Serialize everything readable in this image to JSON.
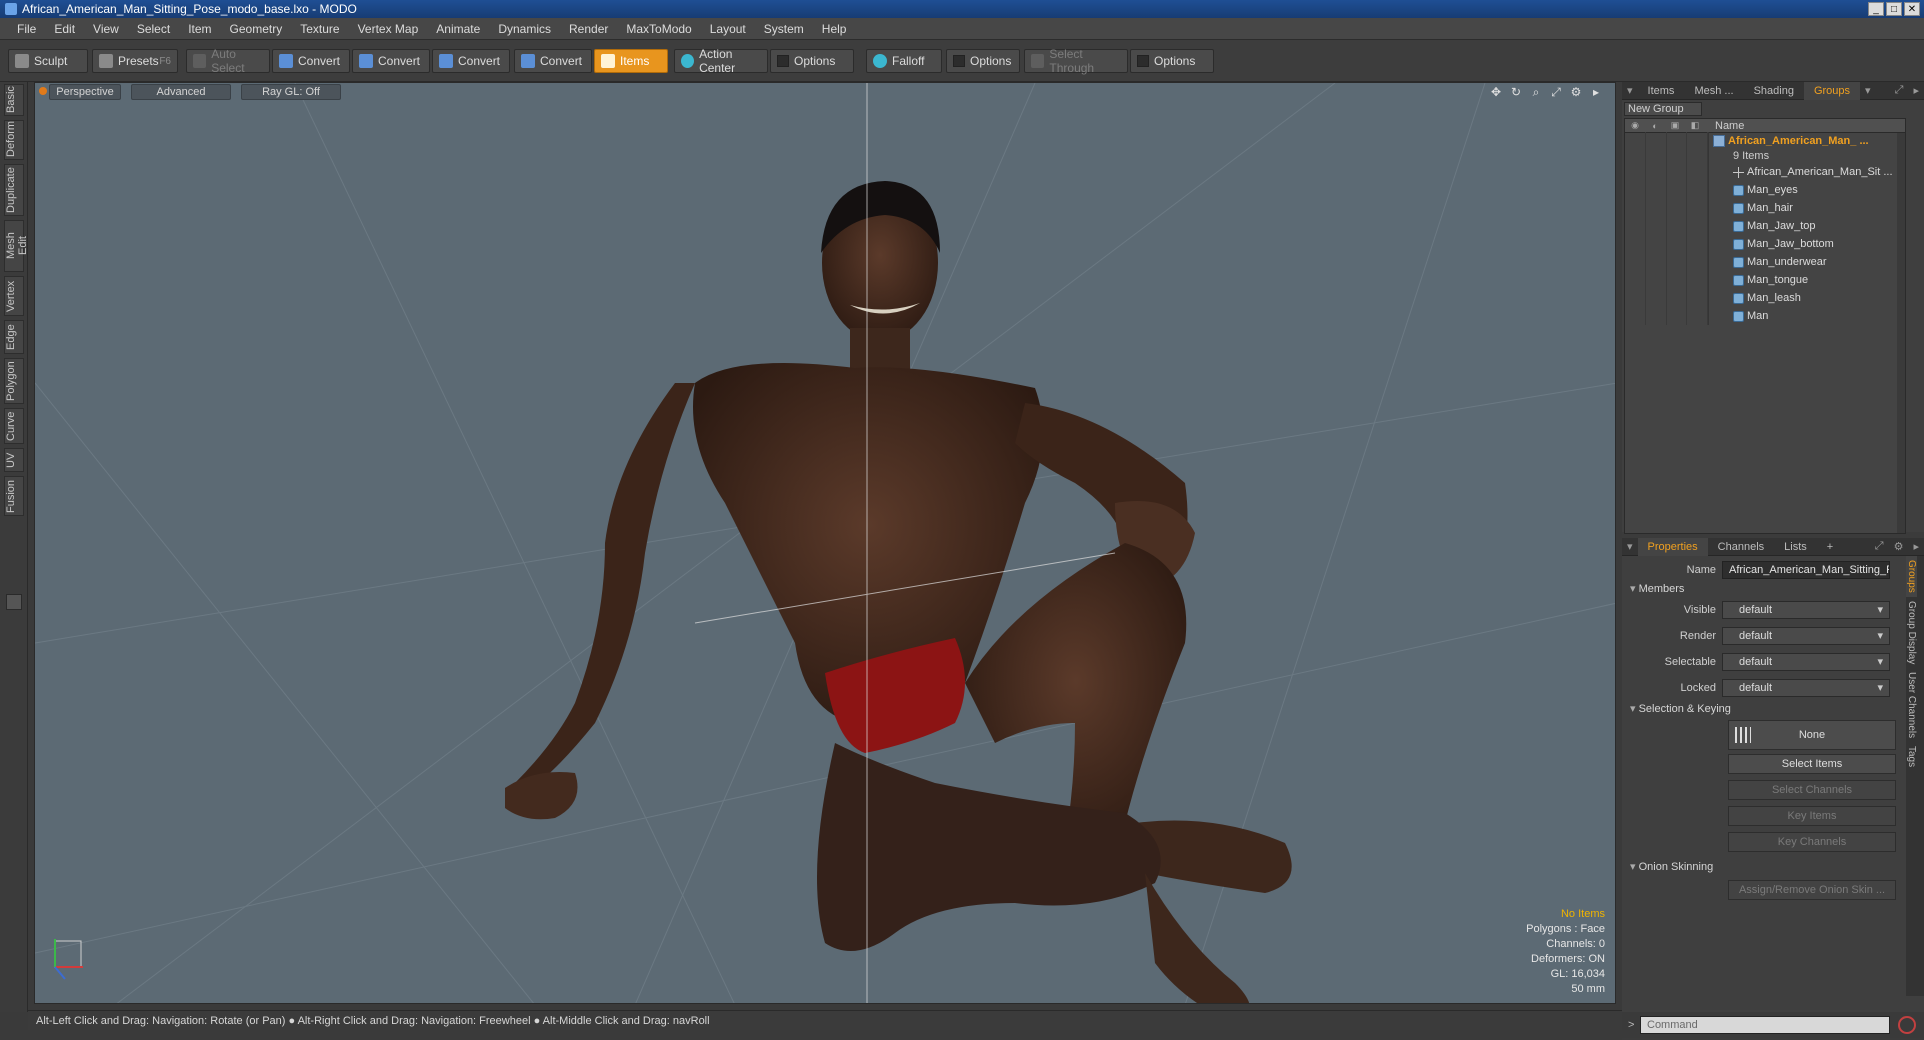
{
  "window": {
    "title": "African_American_Man_Sitting_Pose_modo_base.lxo - MODO"
  },
  "menu": [
    "File",
    "Edit",
    "View",
    "Select",
    "Item",
    "Geometry",
    "Texture",
    "Vertex Map",
    "Animate",
    "Dynamics",
    "Render",
    "MaxToModo",
    "Layout",
    "System",
    "Help"
  ],
  "toolbar": {
    "sculpt": "Sculpt",
    "presets": "Presets",
    "presets_key": "F6",
    "auto_select": "Auto Select",
    "convert": "Convert",
    "items": "Items",
    "action_center": "Action Center",
    "options": "Options",
    "falloff": "Falloff",
    "select_through": "Select Through"
  },
  "left_tabs": [
    "Basic",
    "Deform",
    "Duplicate",
    "Mesh Edit",
    "Vertex",
    "Edge",
    "Polygon",
    "Curve",
    "UV",
    "Fusion"
  ],
  "viewport": {
    "view": "Perspective",
    "mode": "Advanced",
    "raygl": "Ray GL: Off",
    "info": {
      "no_items": "No Items",
      "polygons": "Polygons : Face",
      "channels": "Channels: 0",
      "deformers": "Deformers: ON",
      "gl": "GL: 16,034",
      "focal": "50 mm"
    }
  },
  "right_top_tabs": [
    "Items",
    "Mesh ...",
    "Shading",
    "Groups"
  ],
  "groups": {
    "new_group": "New Group",
    "name_header": "Name",
    "group_name": "African_American_Man_ ...",
    "group_count": "9 Items",
    "children": [
      {
        "label": "African_American_Man_Sit ...",
        "icon": "locator-icon"
      },
      {
        "label": "Man_eyes",
        "icon": "mesh-icon"
      },
      {
        "label": "Man_hair",
        "icon": "mesh-icon"
      },
      {
        "label": "Man_Jaw_top",
        "icon": "mesh-icon"
      },
      {
        "label": "Man_Jaw_bottom",
        "icon": "mesh-icon"
      },
      {
        "label": "Man_underwear",
        "icon": "mesh-icon"
      },
      {
        "label": "Man_tongue",
        "icon": "mesh-icon"
      },
      {
        "label": "Man_leash",
        "icon": "mesh-icon"
      },
      {
        "label": "Man",
        "icon": "mesh-icon"
      }
    ]
  },
  "props_tabs": [
    "Properties",
    "Channels",
    "Lists",
    "+"
  ],
  "properties": {
    "name_label": "Name",
    "name_value": "African_American_Man_Sitting_F",
    "members": "Members",
    "visible_label": "Visible",
    "render_label": "Render",
    "selectable_label": "Selectable",
    "locked_label": "Locked",
    "default_value": "default",
    "selection_keying": "Selection & Keying",
    "none": "None",
    "select_items": "Select Items",
    "select_channels": "Select Channels",
    "key_items": "Key Items",
    "key_channels": "Key Channels",
    "onion_skinning": "Onion Skinning",
    "assign_onion": "Assign/Remove Onion Skin ..."
  },
  "right_vtabs": [
    "Groups",
    "Group Display",
    "User Channels",
    "Tags"
  ],
  "command": {
    "placeholder": "Command",
    "prompt": ">"
  },
  "status": "Alt-Left Click and Drag: Navigation: Rotate (or Pan) ● Alt-Right Click and Drag: Navigation: Freewheel ● Alt-Middle Click and Drag: navRoll"
}
